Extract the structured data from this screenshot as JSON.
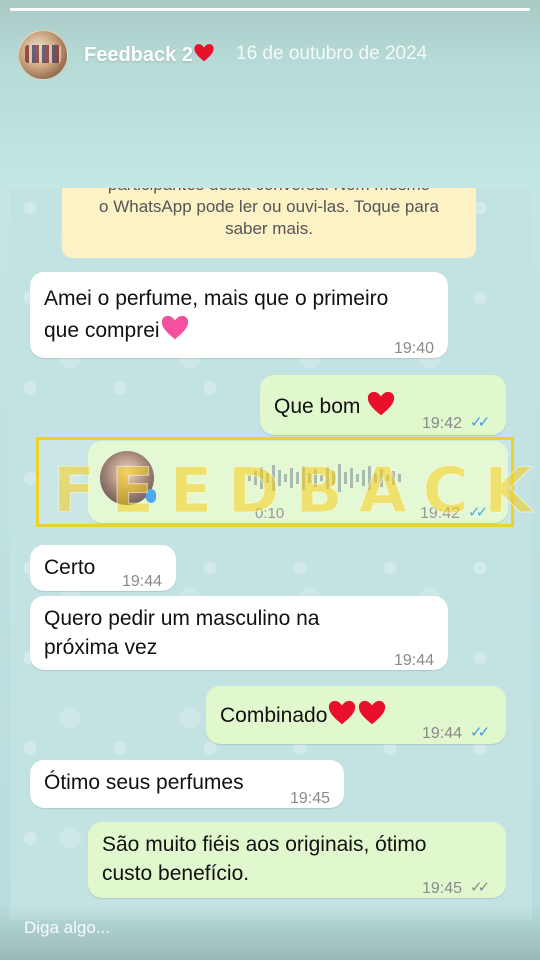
{
  "story": {
    "title": "Feedback 2",
    "date": "16 de outubro de 2024",
    "progress": 1.0
  },
  "chat": {
    "encryption_notice": [
      "participantes desta conversa. Nem mesmo",
      "o WhatsApp pode ler ou ouvi-las. Toque para",
      "saber mais."
    ],
    "messages": [
      {
        "dir": "in",
        "text_lines": [
          "Amei o perfume, mais que o primeiro",
          "que comprei"
        ],
        "time": "19:40"
      },
      {
        "dir": "out",
        "text": "Que bom",
        "time": "19:42",
        "status": "read"
      },
      {
        "dir": "out",
        "type": "voice",
        "duration": "0:10",
        "time": "19:42",
        "status": "read"
      },
      {
        "dir": "in",
        "text": "Certo",
        "time": "19:44"
      },
      {
        "dir": "in",
        "text_lines": [
          "Quero pedir um masculino na",
          "próxima vez"
        ],
        "time": "19:44"
      },
      {
        "dir": "out",
        "text": "Combinado",
        "time": "19:44",
        "status": "read"
      },
      {
        "dir": "in",
        "text": "Ótimo seus perfumes",
        "time": "19:45"
      },
      {
        "dir": "out",
        "text_lines": [
          "São muito fiéis aos originais, ótimo",
          "custo benefício."
        ],
        "time": "19:45",
        "status": "delivered"
      }
    ]
  },
  "watermark": {
    "text": "FEEDBACK"
  },
  "reply": {
    "placeholder": "Diga algo..."
  },
  "colors": {
    "incoming": "#ffffff",
    "outgoing": "#e1f7cd",
    "read_ticks": "#3b9ee6",
    "watermark": "#f1cf2a",
    "heart": "#e8102a"
  },
  "icons": {
    "heart": "red-heart-emoji",
    "pink_heart": "pink-heart-emoji",
    "ticks": "double-check-icon",
    "mic": "microphone-icon"
  }
}
